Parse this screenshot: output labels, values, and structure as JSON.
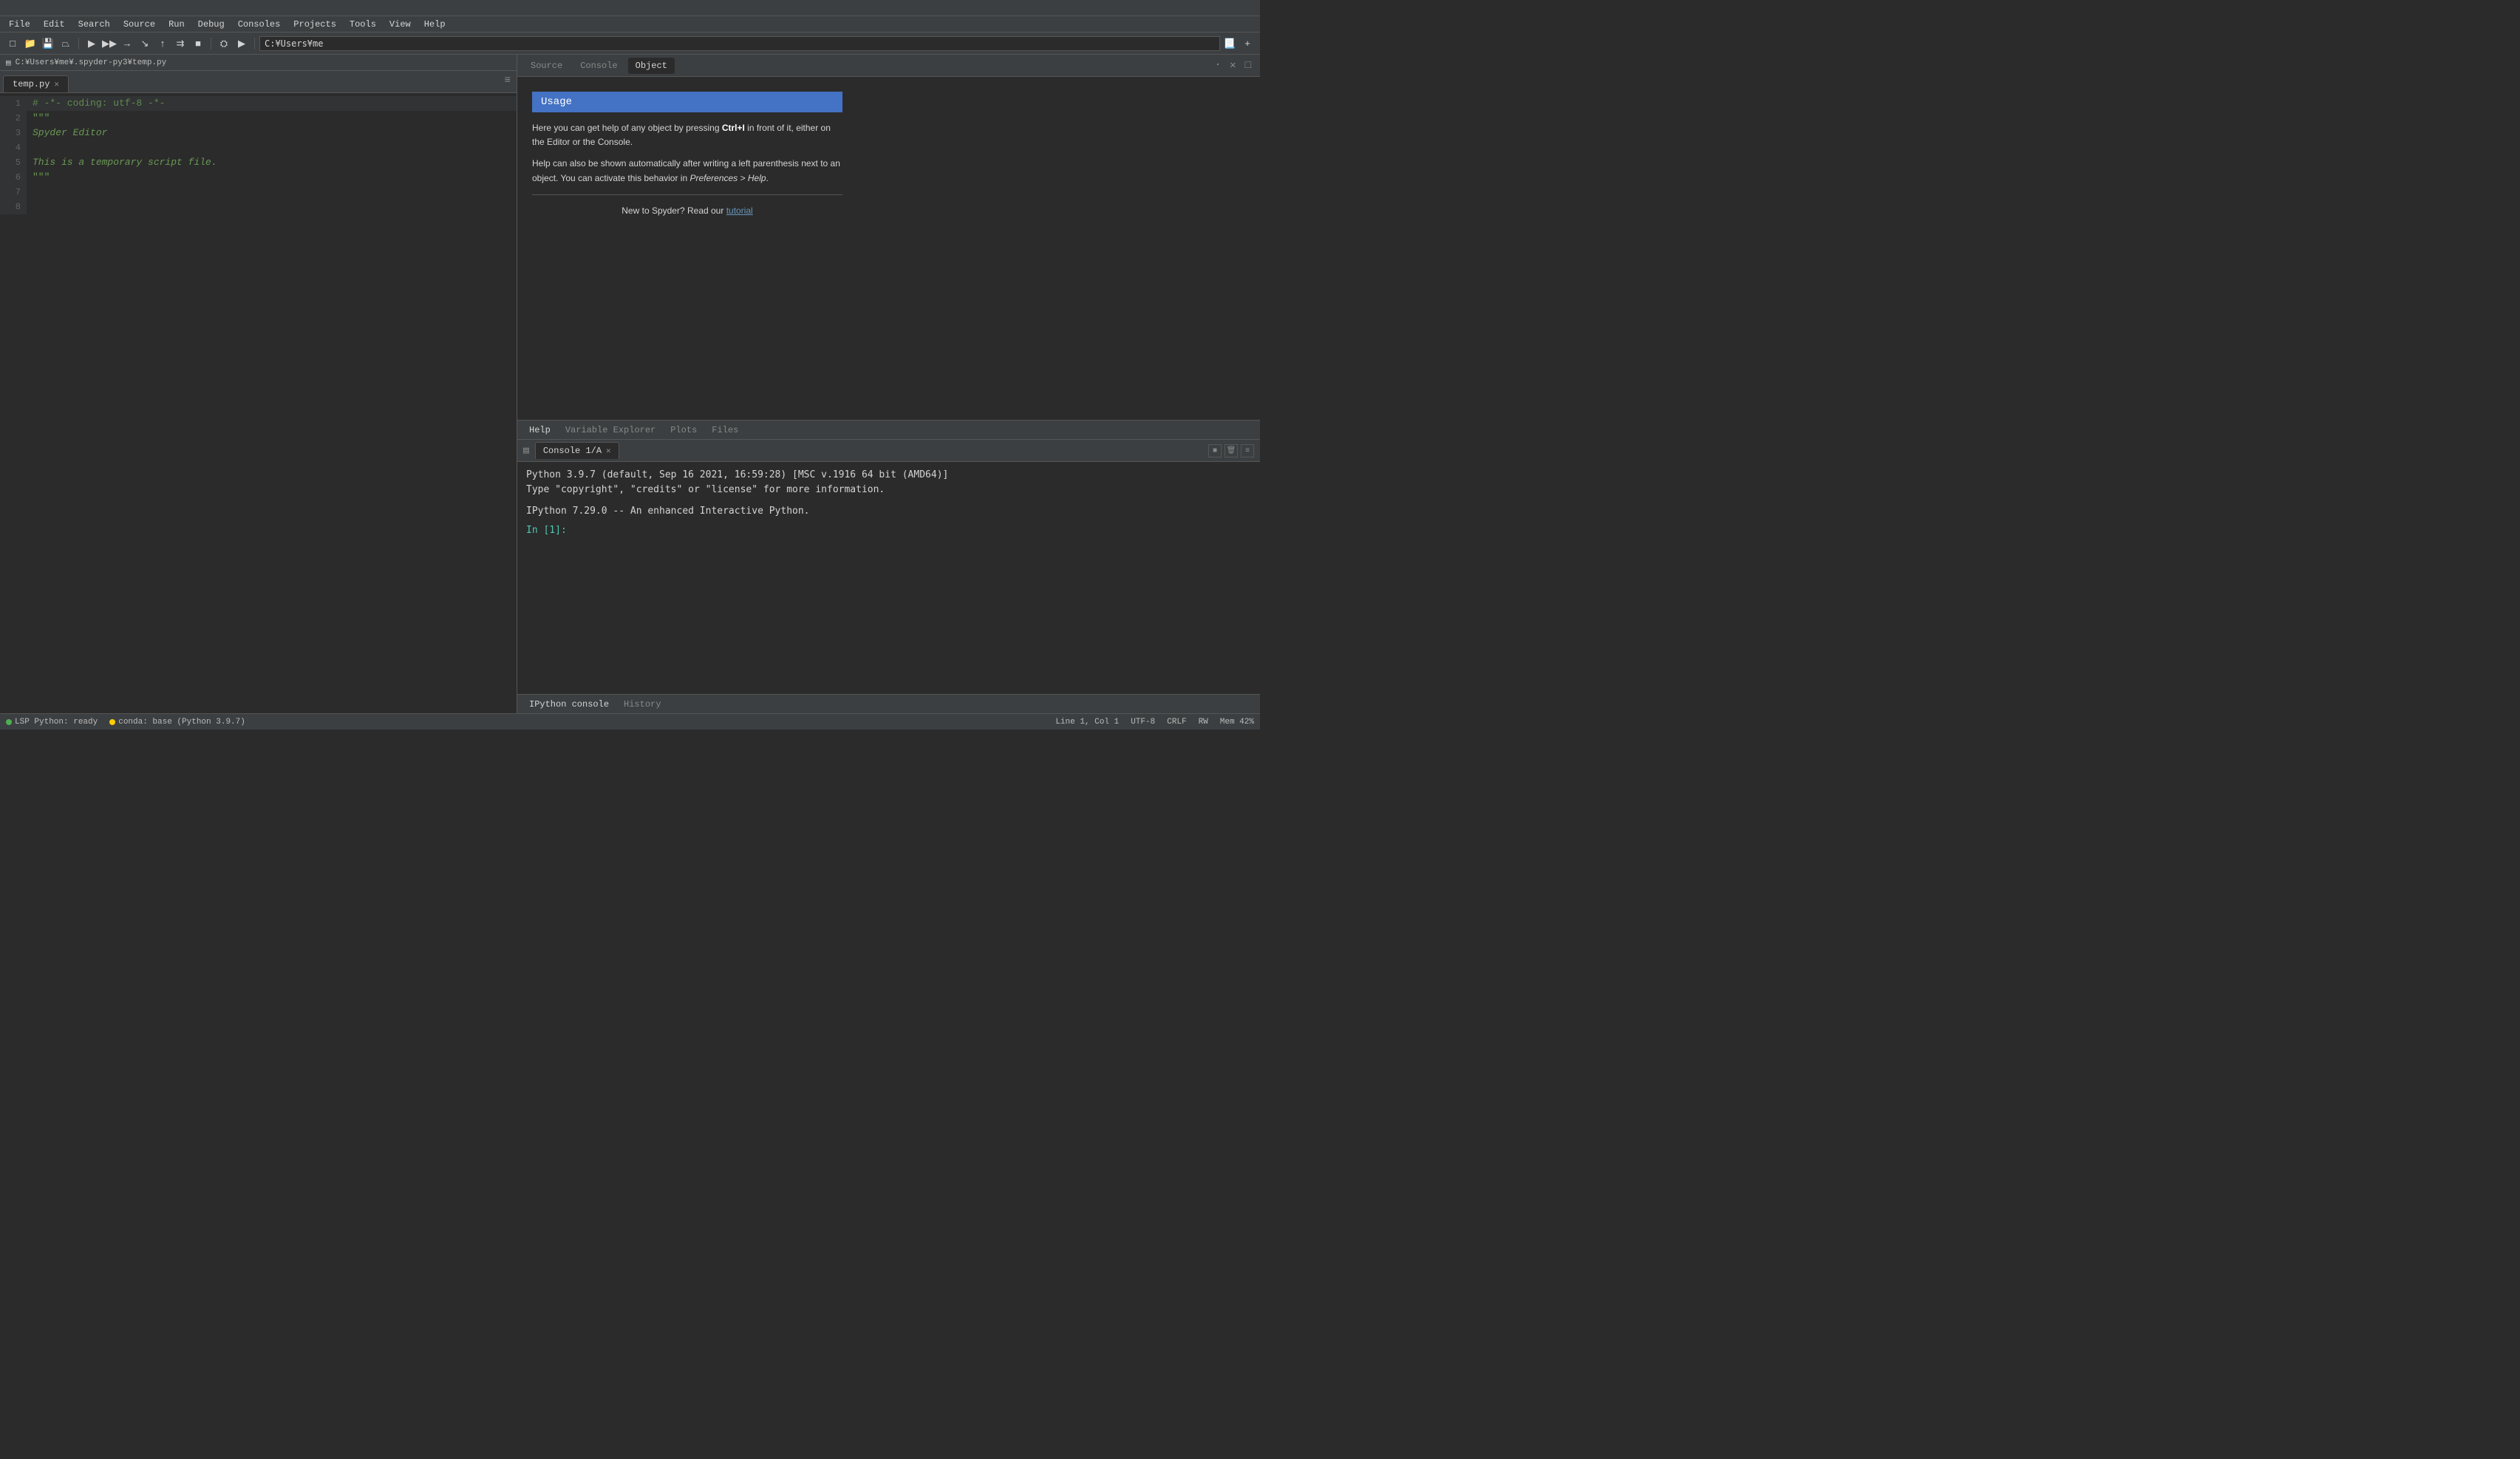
{
  "titlebar": {
    "text": ""
  },
  "menubar": {
    "items": [
      "File",
      "Edit",
      "Search",
      "Source",
      "Run",
      "Debug",
      "Consoles",
      "Projects",
      "Tools",
      "View",
      "Help"
    ]
  },
  "toolbar": {
    "path": "C:¥Users¥me",
    "buttons": [
      "new",
      "open",
      "save",
      "saveas",
      "run",
      "debug",
      "step",
      "stepinto",
      "stepout",
      "continue",
      "stop",
      "settings",
      "other"
    ]
  },
  "editor": {
    "breadcrumb": "C:¥Users¥me¥.spyder-py3¥temp.py",
    "tab_name": "temp.py",
    "lines": [
      {
        "num": "1",
        "content": "# -*- coding: utf-8 -*-",
        "style": "comment"
      },
      {
        "num": "2",
        "content": "\"\"\"",
        "style": "green"
      },
      {
        "num": "3",
        "content": "Spyder Editor",
        "style": "italic-green"
      },
      {
        "num": "4",
        "content": "",
        "style": "normal"
      },
      {
        "num": "5",
        "content": "This is a temporary script file.",
        "style": "italic-green"
      },
      {
        "num": "6",
        "content": "\"\"\"",
        "style": "green"
      },
      {
        "num": "7",
        "content": "",
        "style": "normal"
      },
      {
        "num": "8",
        "content": "",
        "style": "normal"
      }
    ]
  },
  "help_panel": {
    "tabs": [
      "Source",
      "Console",
      "Object"
    ],
    "active_tab": "Object",
    "usage_title": "Usage",
    "help_text_1": "Here you can get help of any object by pressing ",
    "help_bold_1": "Ctrl+I",
    "help_text_2": " in front of it, either on the Editor or the Console.",
    "help_text_3": "Help can also be shown automatically after writing a left parenthesis next to an object. You can activate this behavior in ",
    "help_italic_1": "Preferences > Help",
    "help_text_4": ".",
    "new_to_spyder": "New to Spyder? Read our ",
    "tutorial_link": "tutorial",
    "bottom_tabs": [
      "Help",
      "Variable Explorer",
      "Plots",
      "Files"
    ],
    "active_bottom_tab": "Help"
  },
  "console_panel": {
    "tab_name": "Console 1/A",
    "python_info": "Python 3.9.7 (default, Sep 16 2021, 16:59:28) [MSC v.1916 64 bit (AMD64)]",
    "python_info2": "Type \"copyright\", \"credits\" or \"license\" for more information.",
    "ipython_info": "IPython 7.29.0 -- An enhanced Interactive Python.",
    "prompt": "In [1]:",
    "bottom_tabs": [
      "IPython console",
      "History"
    ],
    "active_bottom_tab": "IPython console"
  },
  "statusbar": {
    "lsp_label": "LSP Python: ready",
    "conda_label": "conda: base (Python 3.9.7)",
    "position": "Line 1, Col 1",
    "encoding": "UTF-8",
    "eol": "CRLF",
    "permissions": "RW",
    "memory": "Mem 42%"
  }
}
